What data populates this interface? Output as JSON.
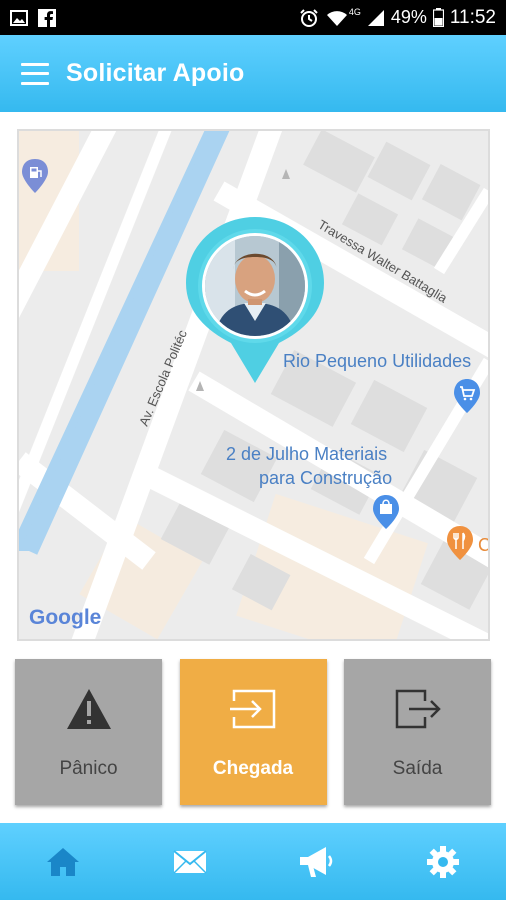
{
  "status_bar": {
    "battery": "49%",
    "time": "11:52",
    "network": "4G",
    "icons": [
      "image-icon",
      "facebook-icon",
      "alarm-icon",
      "wifi-icon",
      "signal-icon",
      "battery-icon"
    ]
  },
  "app_bar": {
    "title": "Solicitar Apoio",
    "menu_icon": "hamburger-menu-icon"
  },
  "map": {
    "labels": {
      "street_1": "Av. Escola Politéc",
      "street_2": "Travessa Walter Battaglia",
      "place_1": "Rio Pequeno Utilidades",
      "place_2_line1": "2 de Julho Materiais",
      "place_2_line2": "para Construção",
      "place_3_partial": "C",
      "attribution": "Google"
    },
    "icons": [
      "gas-station-icon",
      "shopping-cart-icon",
      "shopping-bag-icon",
      "restaurant-icon",
      "user-location-pin"
    ]
  },
  "actions": [
    {
      "id": "panic",
      "label": "Pânico",
      "icon": "warning-icon",
      "active": false
    },
    {
      "id": "arrival",
      "label": "Chegada",
      "icon": "sign-in-icon",
      "active": true
    },
    {
      "id": "exit",
      "label": "Saída",
      "icon": "sign-out-icon",
      "active": false
    }
  ],
  "bottom_nav": [
    {
      "id": "home",
      "icon": "home-icon",
      "active": true
    },
    {
      "id": "messages",
      "icon": "mail-icon",
      "active": false
    },
    {
      "id": "announcements",
      "icon": "megaphone-icon",
      "active": false
    },
    {
      "id": "settings",
      "icon": "gear-icon",
      "active": false
    }
  ],
  "colors": {
    "primary": "#35b9ef",
    "accent": "#f0ad45",
    "card_inactive": "#a6a6a6",
    "nav_active": "#1a86c8",
    "pin": "#4fcfe3"
  }
}
